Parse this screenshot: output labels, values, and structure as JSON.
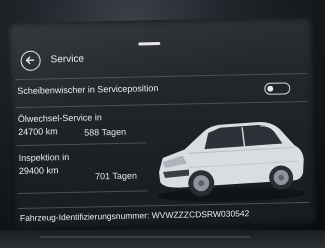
{
  "header": {
    "title": "Service",
    "back_icon": "back-arrow-icon"
  },
  "wiper": {
    "label": "Scheibenwischer in Serviceposition",
    "toggle_state": "off"
  },
  "oil_service": {
    "label": "Ölwechsel-Service in",
    "km": "24700 km",
    "days": "588 Tagen"
  },
  "inspection": {
    "label": "Inspektion in",
    "km": "29400 km",
    "days": "701 Tagen"
  },
  "vin": {
    "text": "Fahrzeug-Identifizierungsnummer: WVWZZZCDSRW030542"
  },
  "colors": {
    "background": "#23272c",
    "text": "#ececec",
    "car_body": "#d9dde2"
  }
}
